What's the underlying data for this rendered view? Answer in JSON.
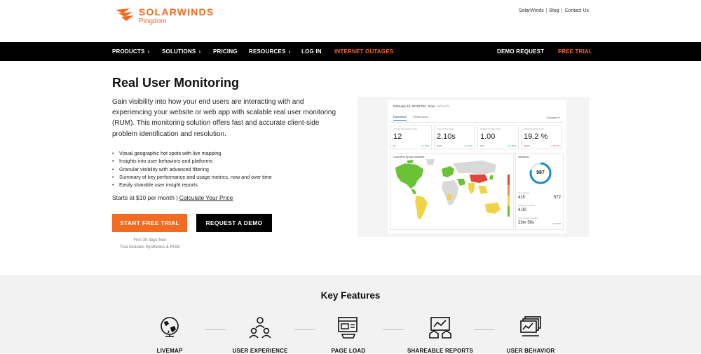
{
  "header": {
    "logo_main": "SOLARWINDS",
    "logo_sub": "Pingdom",
    "util_links": [
      "SolarWinds",
      "Blog",
      "Contact Us"
    ],
    "util_sep": "|"
  },
  "nav": {
    "products": "PRODUCTS",
    "solutions": "SOLUTIONS",
    "pricing": "PRICING",
    "resources": "RESOURCES",
    "login": "LOG IN",
    "outages": "INTERNET OUTAGES",
    "demo_request": "DEMO REQUEST",
    "free_trial": "FREE TRIAL",
    "chevron": "›"
  },
  "hero": {
    "title": "Real User Monitoring",
    "description": "Gain visibility into how your end users are interacting with and experiencing your website or web app with scalable real user monitoring (RUM). This monitoring solution offers fast and accurate client-side problem identification and resolution.",
    "bullets": [
      "Visual geographic hot spots with live mapping",
      "Insights into user behaviors and platforms",
      "Granular visibility with advanced filtering",
      "Summary of key performance and usage metrics, now and over time",
      "Easily sharable user insight reports"
    ],
    "pricing_text": "Starts at $10 per month | ",
    "pricing_link": "Calculate Your Price",
    "start_trial": "START FREE TRIAL",
    "request_demo": "REQUEST A DEMO",
    "trial_note_1": "First 30 days free",
    "trial_note_2": "Trial includes Synthetics & RUM"
  },
  "dashboard": {
    "date": "February 15, 02:30 PM - Now",
    "timezone": "US/Pacific",
    "tab_experience": "Experience",
    "tab_performance": "Performance",
    "pages": "All pages ▾",
    "metrics": [
      {
        "label": "ACTIVE SESSIONS NOW",
        "value": "12",
        "prev": "12",
        "change": "▲ 0.00%",
        "negative": false
      },
      {
        "label": "LOAD TIME NOW",
        "value": "2.10s",
        "prev": "2.02s",
        "change": "▲ 0.07%",
        "negative": false
      },
      {
        "label": "APDEX SCORE NOW",
        "value": "1.00",
        "prev": "0.97",
        "change": "▲ 7.05%",
        "negative": false
      },
      {
        "label": "BOUNCE RATE NOW",
        "value": "19.2 %",
        "prev": "16.6%",
        "change": "▲ 80.7%",
        "negative": true
      }
    ],
    "map_title": "Load time by top countries",
    "sessions_title": "Sessions",
    "sessions_total": "987",
    "sessions_rows": [
      {
        "label": "New visitors",
        "value": "415",
        "value2": "572"
      },
      {
        "label": "Pages per session",
        "value": "4.00"
      },
      {
        "label": "Avg. session duration",
        "value": "23m 50s",
        "change": "▲ 0.07%"
      }
    ],
    "colors": {
      "good": "#6ac237",
      "ok": "#f0d348",
      "slow": "#ef8a4a",
      "bad": "#e0453a",
      "none": "#d9d9d9",
      "ring": "#1e88d0"
    }
  },
  "features": {
    "title": "Key Features",
    "items": [
      {
        "label": "LIVEMAP",
        "icon": "globe-icon"
      },
      {
        "label": "USER EXPERIENCE",
        "icon": "users-icon"
      },
      {
        "label": "PAGE LOAD",
        "icon": "page-load-icon"
      },
      {
        "label": "SHAREABLE REPORTS",
        "icon": "report-icon"
      },
      {
        "label": "USER BEHAVIOR",
        "icon": "behavior-icon"
      }
    ]
  },
  "colors": {
    "brand_orange": "#f36b21",
    "nav_bg": "#000000",
    "features_bg": "#f2f2f2"
  }
}
